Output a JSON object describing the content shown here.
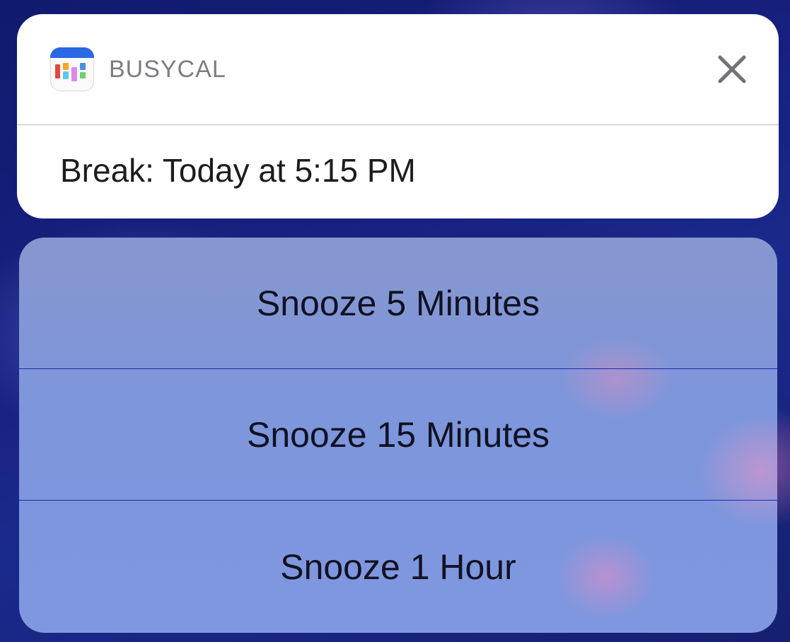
{
  "notification": {
    "app_name": "BUSYCAL",
    "icon": "busycal-app-icon",
    "close_icon": "close-icon",
    "message": "Break: Today at 5:15 PM"
  },
  "actions": [
    {
      "label": "Snooze 5 Minutes"
    },
    {
      "label": "Snooze 15 Minutes"
    },
    {
      "label": "Snooze 1 Hour"
    }
  ],
  "colors": {
    "icon_bar": "#2a67e3",
    "app_name_text": "#7c7c81",
    "action_divider": "#1e2ab0"
  }
}
